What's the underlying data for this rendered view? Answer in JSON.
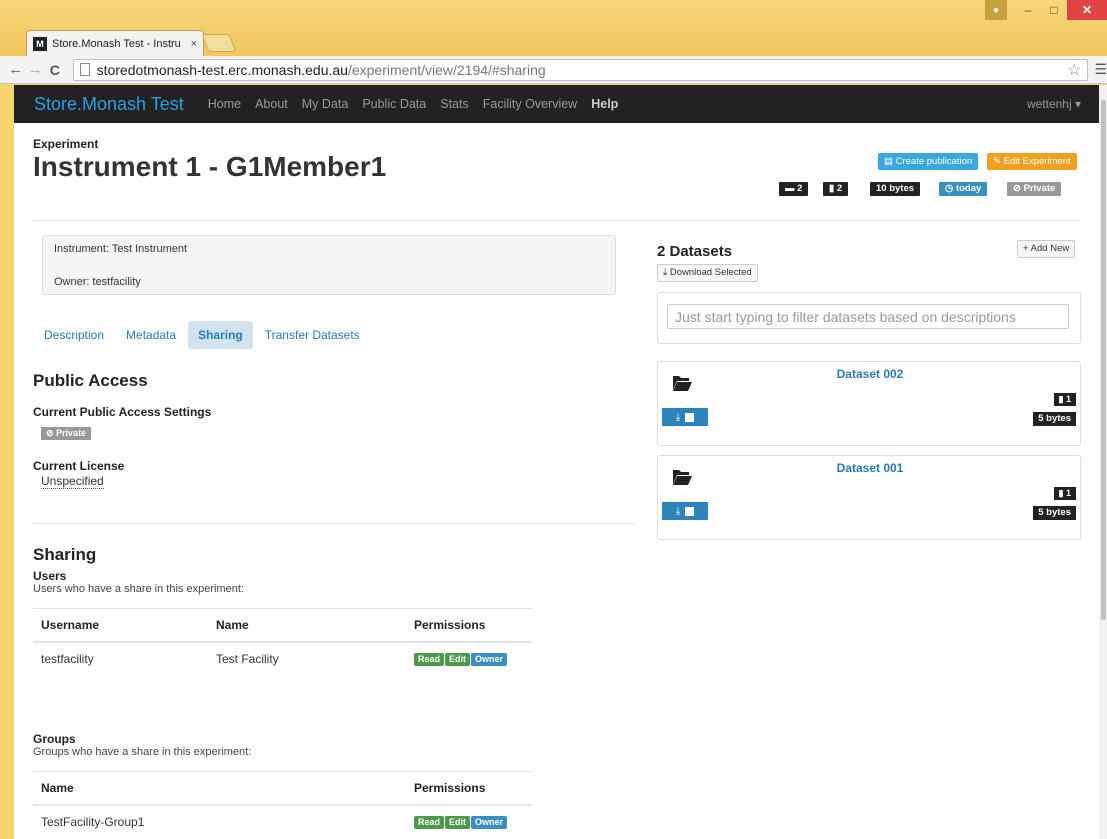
{
  "browser": {
    "tab_title": "Store.Monash Test - Instru",
    "tab_close": "×",
    "url_host": "storedotmonash-test.erc.monash.edu.au",
    "url_path": "/experiment/view/2194/#sharing"
  },
  "navbar": {
    "brand": "Store.Monash Test",
    "links": [
      "Home",
      "About",
      "My Data",
      "Public Data",
      "Stats",
      "Facility Overview",
      "Help"
    ],
    "user": "wettenhj ▾"
  },
  "experiment": {
    "label": "Experiment",
    "title": "Instrument 1 - G1Member1",
    "create_publication": "Create publication",
    "edit_experiment": "Edit Experiment",
    "badges": {
      "datasets": "2",
      "files": "2",
      "size": "10 bytes",
      "updated": "today",
      "access": "Private"
    },
    "instrument": "Instrument: Test Instrument",
    "owner": "Owner: testfacility"
  },
  "tabs": [
    {
      "label": "Description",
      "active": false
    },
    {
      "label": "Metadata",
      "active": false
    },
    {
      "label": "Sharing",
      "active": true
    },
    {
      "label": "Transfer Datasets",
      "active": false
    }
  ],
  "public_access": {
    "heading": "Public Access",
    "settings_label": "Current Public Access Settings",
    "settings_value": "Private",
    "license_label": "Current License",
    "license_value": "Unspecified"
  },
  "sharing": {
    "heading": "Sharing",
    "users_label": "Users",
    "users_desc": "Users who have a share in this experiment:",
    "users_headers": [
      "Username",
      "Name",
      "Permissions"
    ],
    "users_rows": [
      {
        "username": "testfacility",
        "name": "Test Facility",
        "perms": [
          "Read",
          "Edit",
          "Owner"
        ]
      }
    ],
    "groups_label": "Groups",
    "groups_desc": "Groups who have a share in this experiment:",
    "groups_headers": [
      "Name",
      "Permissions"
    ],
    "groups_rows": [
      {
        "name": "TestFacility-Group1",
        "perms": [
          "Read",
          "Edit",
          "Owner"
        ]
      }
    ]
  },
  "datasets": {
    "heading": "2 Datasets",
    "add_new": "+ Add New",
    "download_selected": "Download Selected",
    "filter_placeholder": "Just start typing to filter datasets based on descriptions",
    "items": [
      {
        "title": "Dataset 002",
        "files": "1",
        "size": "5 bytes"
      },
      {
        "title": "Dataset 001",
        "files": "1",
        "size": "5 bytes"
      }
    ]
  },
  "colors": {
    "brand": "#2f9fe0",
    "primary_btn": "#3aa8db",
    "warning_btn": "#f0a020",
    "success": "#4a9a4a",
    "info": "#3a8fc0"
  }
}
